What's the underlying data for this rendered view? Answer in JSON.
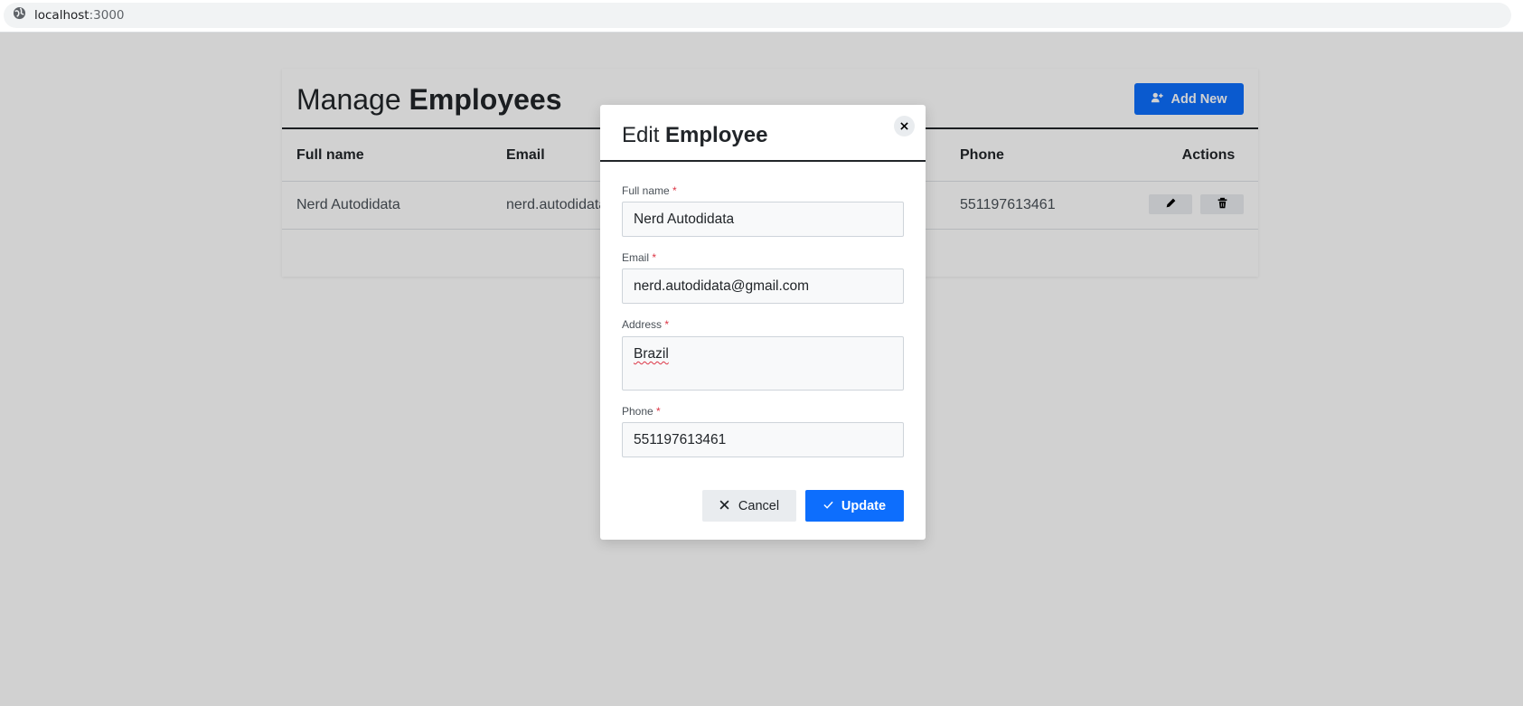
{
  "browser": {
    "url_host": "localhost",
    "url_port": ":3000"
  },
  "page": {
    "title_light": "Manage",
    "title_bold": "Employees",
    "add_button_label": "Add New",
    "table": {
      "columns": [
        "Full name",
        "Email",
        "Phone",
        "Actions"
      ],
      "rows": [
        {
          "full_name": "Nerd Autodidata",
          "email": "nerd.autodidata@gmail.com",
          "phone": "551197613461"
        }
      ]
    }
  },
  "dialog": {
    "title_light": "Edit",
    "title_bold": "Employee",
    "required_mark": "*",
    "fields": {
      "full_name": {
        "label": "Full name",
        "value": "Nerd Autodidata"
      },
      "email": {
        "label": "Email",
        "value": "nerd.autodidata@gmail.com"
      },
      "address": {
        "label": "Address",
        "value": "Brazil"
      },
      "phone": {
        "label": "Phone",
        "value": "551197613461"
      }
    },
    "cancel_label": "Cancel",
    "update_label": "Update"
  },
  "icons": {
    "browser": "globe-icon",
    "add": "user-plus-icon",
    "edit": "pencil-icon",
    "delete": "trash-icon",
    "close": "close-icon",
    "cancel": "x-icon",
    "update": "check-icon"
  },
  "colors": {
    "primary": "#0d6efd",
    "required": "#dc3545",
    "secondary_button": "#e9ecef"
  }
}
